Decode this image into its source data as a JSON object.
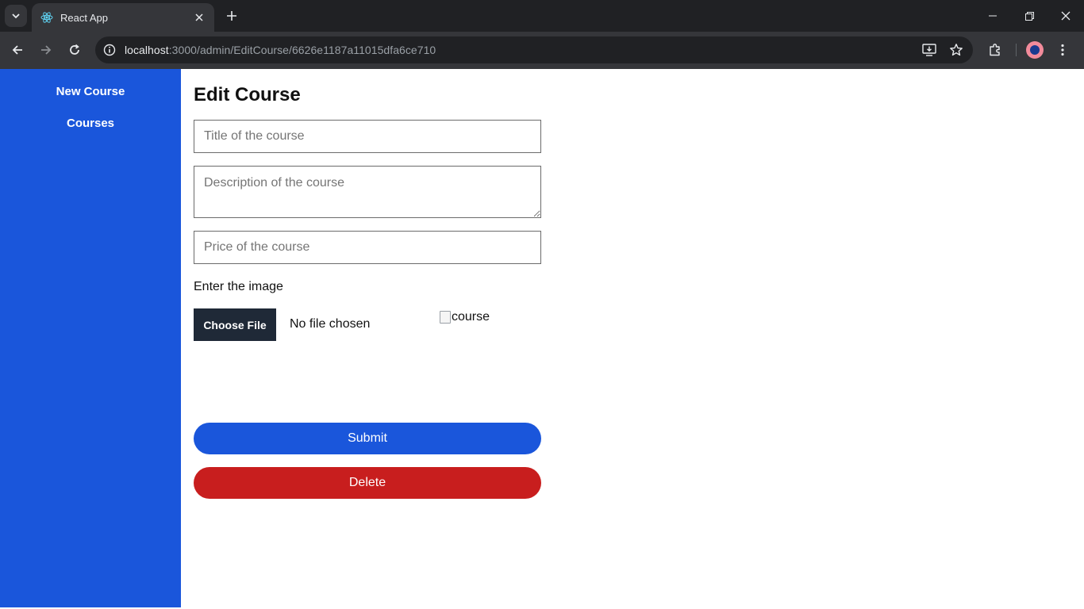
{
  "browser": {
    "tab_title": "React App",
    "url_host": "localhost",
    "url_path": ":3000/admin/EditCourse/6626e1187a11015dfa6ce710"
  },
  "sidebar": {
    "items": [
      {
        "label": "New Course"
      },
      {
        "label": "Courses"
      }
    ]
  },
  "form": {
    "title": "Edit Course",
    "title_field": {
      "value": "",
      "placeholder": "Title of the course"
    },
    "description_field": {
      "value": "",
      "placeholder": "Description of the course"
    },
    "price_field": {
      "value": "",
      "placeholder": "Price of the course"
    },
    "image_label": "Enter the image",
    "file_button_label": "Choose File",
    "file_status": "No file chosen",
    "image_alt": "course",
    "submit_label": "Submit",
    "delete_label": "Delete"
  },
  "colors": {
    "sidebar": "#1a56db",
    "submit": "#1a56db",
    "delete": "#c81e1e",
    "file_button": "#1f2937"
  }
}
